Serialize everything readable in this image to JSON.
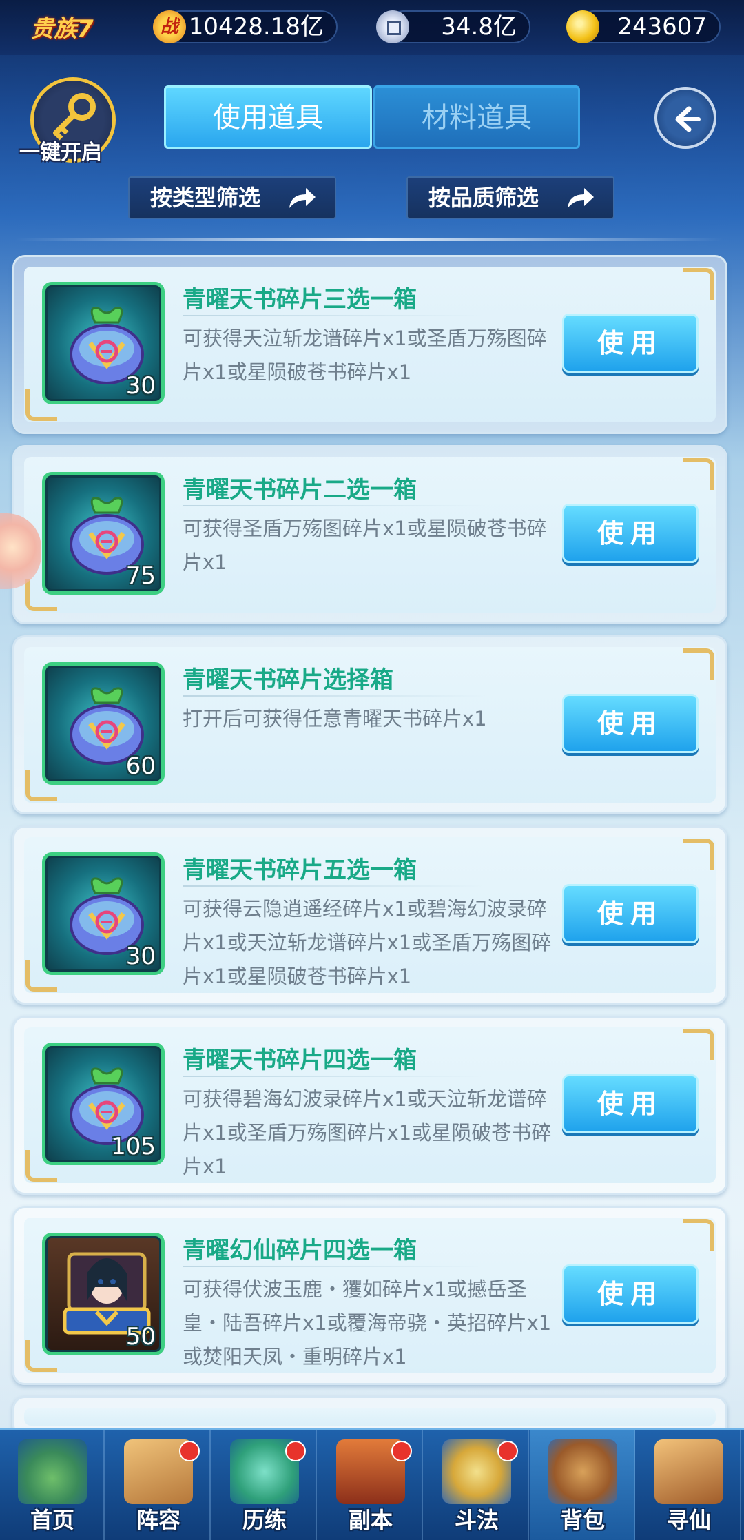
{
  "header": {
    "vip_label": "贵族7",
    "power_icon": "战",
    "power_value": "10428.18亿",
    "coin_value": "34.8亿",
    "gold_value": "243607"
  },
  "toolbar": {
    "open_all_label": "一键开启",
    "tabs": [
      {
        "label": "使用道具",
        "active": true
      },
      {
        "label": "材料道具",
        "active": false
      }
    ],
    "filter_type_label": "按类型筛选",
    "filter_quality_label": "按品质筛选"
  },
  "items": [
    {
      "title": "青曜天书碎片三选一箱",
      "desc": "可获得天泣斩龙谱碎片x1或圣盾万殇图碎片x1或星陨破苍书碎片x1",
      "count": "30",
      "button": "使用",
      "icon": "bag-icon"
    },
    {
      "title": "青曜天书碎片二选一箱",
      "desc": "可获得圣盾万殇图碎片x1或星陨破苍书碎片x1",
      "count": "75",
      "button": "使用",
      "icon": "bag-icon"
    },
    {
      "title": "青曜天书碎片选择箱",
      "desc": "打开后可获得任意青曜天书碎片x1",
      "count": "60",
      "button": "使用",
      "icon": "bag-icon"
    },
    {
      "title": "青曜天书碎片五选一箱",
      "desc": "可获得云隐逍遥经碎片x1或碧海幻波录碎片x1或天泣斩龙谱碎片x1或圣盾万殇图碎片x1或星陨破苍书碎片x1",
      "count": "30",
      "button": "使用",
      "icon": "bag-icon"
    },
    {
      "title": "青曜天书碎片四选一箱",
      "desc": "可获得碧海幻波录碎片x1或天泣斩龙谱碎片x1或圣盾万殇图碎片x1或星陨破苍书碎片x1",
      "count": "105",
      "button": "使用",
      "icon": "bag-icon"
    },
    {
      "title": "青曜幻仙碎片四选一箱",
      "desc": "可获得伏波玉鹿・玃如碎片x1或撼岳圣皇・陆吾碎片x1或覆海帝骁・英招碎片x1或焚阳天凤・重明碎片x1",
      "count": "50",
      "button": "使用",
      "icon": "hero-chest-icon"
    }
  ],
  "nav": [
    {
      "label": "首页",
      "badge": false,
      "active": false
    },
    {
      "label": "阵容",
      "badge": true,
      "active": false
    },
    {
      "label": "历练",
      "badge": true,
      "active": false
    },
    {
      "label": "副本",
      "badge": true,
      "active": false
    },
    {
      "label": "斗法",
      "badge": true,
      "active": false
    },
    {
      "label": "背包",
      "badge": false,
      "active": true
    },
    {
      "label": "寻仙",
      "badge": false,
      "active": false
    }
  ],
  "colors": {
    "accent": "#2aa6ee",
    "title_green": "#19a987",
    "badge_red": "#e8332c",
    "gold_border": "#e4bd66"
  }
}
